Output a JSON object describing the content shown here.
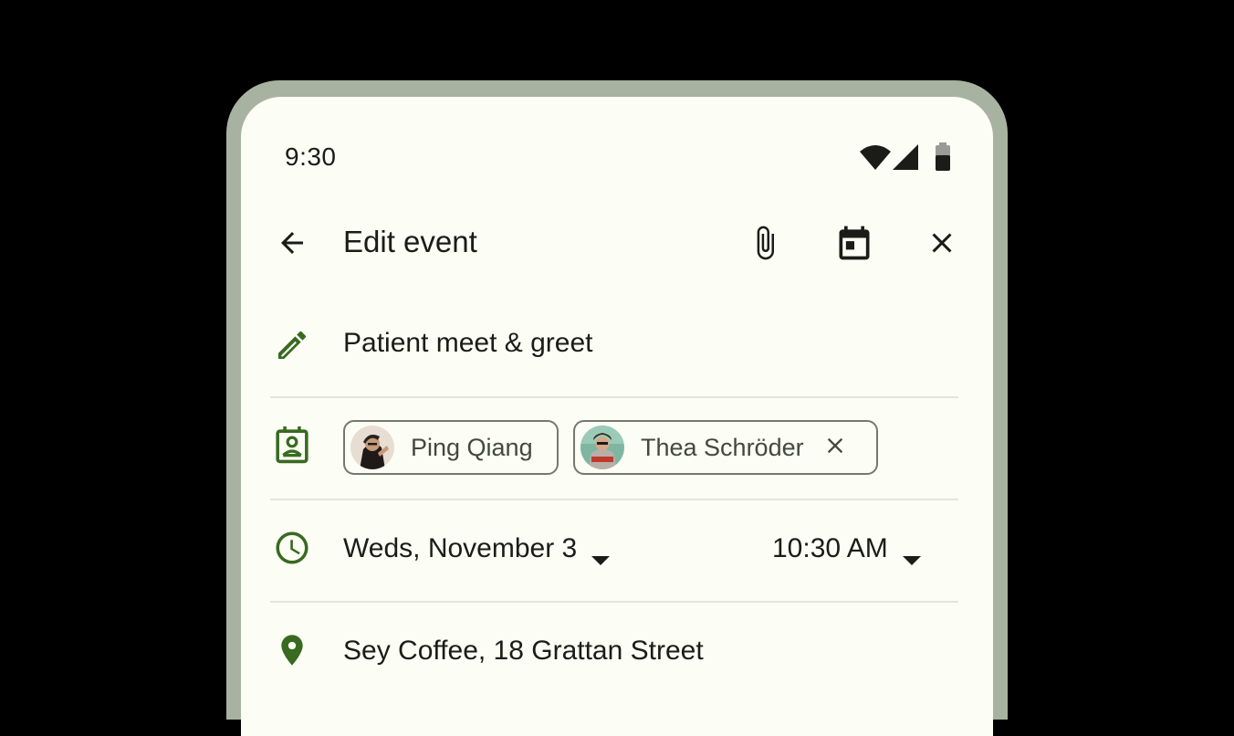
{
  "status_bar": {
    "time": "9:30",
    "icons": [
      "wifi-icon",
      "cell-signal-icon",
      "battery-icon"
    ]
  },
  "app_bar": {
    "title": "Edit event",
    "back_icon": "arrow-back-icon",
    "actions": [
      "attach-icon",
      "calendar-icon",
      "close-icon"
    ]
  },
  "event": {
    "title": "Patient meet & greet",
    "guests": [
      {
        "name": "Ping Qiang",
        "removable": false
      },
      {
        "name": "Thea Schröder",
        "removable": true
      }
    ],
    "date": "Weds, November 3",
    "time": "10:30 AM",
    "location": "Sey Coffee, 18 Grattan Street"
  },
  "colors": {
    "background": "#000000",
    "device_frame": "#a8b2a0",
    "surface": "#fcfdf5",
    "on_surface": "#1b1c18",
    "accent_green": "#386a20",
    "outline": "#75796d",
    "divider": "#e3e4dc"
  }
}
